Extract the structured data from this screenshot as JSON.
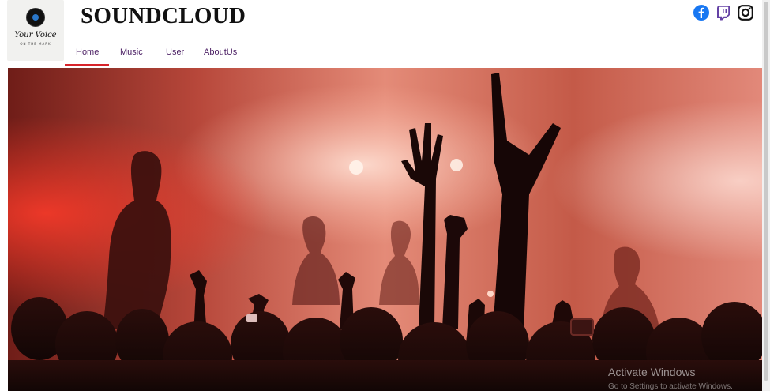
{
  "header": {
    "logo": {
      "script_text": "Your Voice",
      "tagline": "ON THE MARK"
    },
    "brand": "SOUNDCLOUD",
    "nav": [
      {
        "label": "Home",
        "active": true
      },
      {
        "label": "Music",
        "active": false
      },
      {
        "label": "User",
        "active": false
      },
      {
        "label": "AboutUs",
        "active": false
      }
    ],
    "social": [
      {
        "icon": "facebook-icon",
        "color": "#1877f2"
      },
      {
        "icon": "twitch-icon",
        "color": "#6441a5"
      },
      {
        "icon": "instagram-icon",
        "color": "#111111"
      }
    ]
  },
  "hero": {
    "image_subject": "concert-crowd-photo",
    "accent_color": "#d8232a"
  },
  "watermark": {
    "title": "Activate Windows",
    "subtitle": "Go to Settings to activate Windows."
  }
}
